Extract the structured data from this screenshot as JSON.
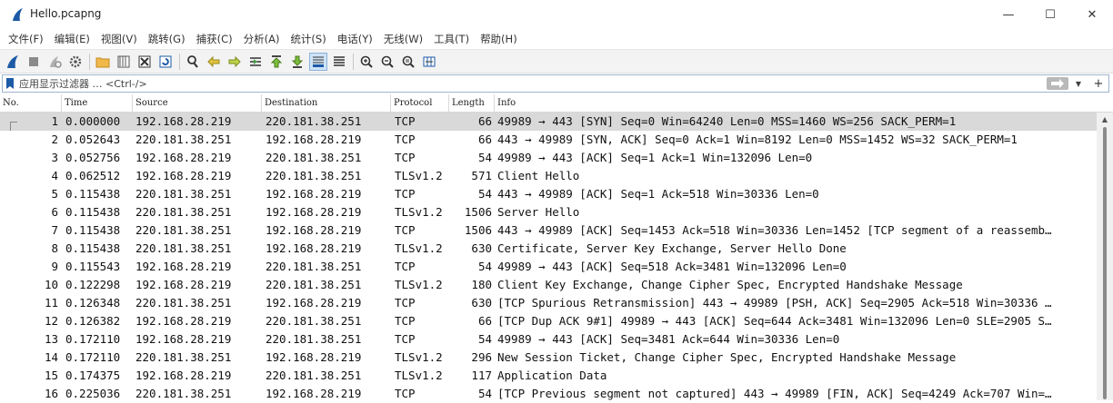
{
  "window": {
    "title": "Hello.pcapng",
    "minimize": "—",
    "maximize": "☐",
    "close": "✕"
  },
  "menu": [
    "文件(F)",
    "编辑(E)",
    "视图(V)",
    "跳转(G)",
    "捕获(C)",
    "分析(A)",
    "统计(S)",
    "电话(Y)",
    "无线(W)",
    "工具(T)",
    "帮助(H)"
  ],
  "toolbar_icons": [
    "start-capture-icon",
    "stop-capture-icon",
    "restart-capture-icon",
    "capture-options-icon",
    "open-file-icon",
    "save-file-icon",
    "close-file-icon",
    "reload-file-icon",
    "find-packet-icon",
    "go-back-icon",
    "go-forward-icon",
    "go-to-packet-icon",
    "first-packet-icon",
    "last-packet-icon",
    "autoscroll-icon",
    "colorize-icon",
    "zoom-in-icon",
    "zoom-out-icon",
    "normal-size-icon",
    "resize-columns-icon"
  ],
  "filter": {
    "placeholder": "应用显示过滤器 … <Ctrl-/>"
  },
  "columns": [
    "No.",
    "Time",
    "Source",
    "Destination",
    "Protocol",
    "Length",
    "Info"
  ],
  "packets": [
    {
      "no": "1",
      "time": "0.000000",
      "src": "192.168.28.219",
      "dst": "220.181.38.251",
      "proto": "TCP",
      "len": "66",
      "info": "49989 → 443 [SYN] Seq=0 Win=64240 Len=0 MSS=1460 WS=256 SACK_PERM=1"
    },
    {
      "no": "2",
      "time": "0.052643",
      "src": "220.181.38.251",
      "dst": "192.168.28.219",
      "proto": "TCP",
      "len": "66",
      "info": "443 → 49989 [SYN, ACK] Seq=0 Ack=1 Win=8192 Len=0 MSS=1452 WS=32 SACK_PERM=1"
    },
    {
      "no": "3",
      "time": "0.052756",
      "src": "192.168.28.219",
      "dst": "220.181.38.251",
      "proto": "TCP",
      "len": "54",
      "info": "49989 → 443 [ACK] Seq=1 Ack=1 Win=132096 Len=0"
    },
    {
      "no": "4",
      "time": "0.062512",
      "src": "192.168.28.219",
      "dst": "220.181.38.251",
      "proto": "TLSv1.2",
      "len": "571",
      "info": "Client Hello"
    },
    {
      "no": "5",
      "time": "0.115438",
      "src": "220.181.38.251",
      "dst": "192.168.28.219",
      "proto": "TCP",
      "len": "54",
      "info": "443 → 49989 [ACK] Seq=1 Ack=518 Win=30336 Len=0"
    },
    {
      "no": "6",
      "time": "0.115438",
      "src": "220.181.38.251",
      "dst": "192.168.28.219",
      "proto": "TLSv1.2",
      "len": "1506",
      "info": "Server Hello"
    },
    {
      "no": "7",
      "time": "0.115438",
      "src": "220.181.38.251",
      "dst": "192.168.28.219",
      "proto": "TCP",
      "len": "1506",
      "info": "443 → 49989 [ACK] Seq=1453 Ack=518 Win=30336 Len=1452 [TCP segment of a reassemb…"
    },
    {
      "no": "8",
      "time": "0.115438",
      "src": "220.181.38.251",
      "dst": "192.168.28.219",
      "proto": "TLSv1.2",
      "len": "630",
      "info": "Certificate, Server Key Exchange, Server Hello Done"
    },
    {
      "no": "9",
      "time": "0.115543",
      "src": "192.168.28.219",
      "dst": "220.181.38.251",
      "proto": "TCP",
      "len": "54",
      "info": "49989 → 443 [ACK] Seq=518 Ack=3481 Win=132096 Len=0"
    },
    {
      "no": "10",
      "time": "0.122298",
      "src": "192.168.28.219",
      "dst": "220.181.38.251",
      "proto": "TLSv1.2",
      "len": "180",
      "info": "Client Key Exchange, Change Cipher Spec, Encrypted Handshake Message"
    },
    {
      "no": "11",
      "time": "0.126348",
      "src": "220.181.38.251",
      "dst": "192.168.28.219",
      "proto": "TCP",
      "len": "630",
      "info": "[TCP Spurious Retransmission] 443 → 49989 [PSH, ACK] Seq=2905 Ack=518 Win=30336 …"
    },
    {
      "no": "12",
      "time": "0.126382",
      "src": "192.168.28.219",
      "dst": "220.181.38.251",
      "proto": "TCP",
      "len": "66",
      "info": "[TCP Dup ACK 9#1] 49989 → 443 [ACK] Seq=644 Ack=3481 Win=132096 Len=0 SLE=2905 S…"
    },
    {
      "no": "13",
      "time": "0.172110",
      "src": "192.168.28.219",
      "dst": "220.181.38.251",
      "proto": "TCP",
      "len": "54",
      "info": "49989 → 443 [ACK] Seq=3481 Ack=644 Win=30336 Len=0"
    },
    {
      "no": "14",
      "time": "0.172110",
      "src": "220.181.38.251",
      "dst": "192.168.28.219",
      "proto": "TLSv1.2",
      "len": "296",
      "info": "New Session Ticket, Change Cipher Spec, Encrypted Handshake Message"
    },
    {
      "no": "15",
      "time": "0.174375",
      "src": "192.168.28.219",
      "dst": "220.181.38.251",
      "proto": "TLSv1.2",
      "len": "117",
      "info": "Application Data"
    },
    {
      "no": "16",
      "time": "0.225036",
      "src": "220.181.38.251",
      "dst": "192.168.28.219",
      "proto": "TCP",
      "len": "54",
      "info": "[TCP Previous segment not captured] 443 → 49989 [FIN, ACK] Seq=4249 Ack=707 Win=…"
    }
  ],
  "selected_packet": "1"
}
